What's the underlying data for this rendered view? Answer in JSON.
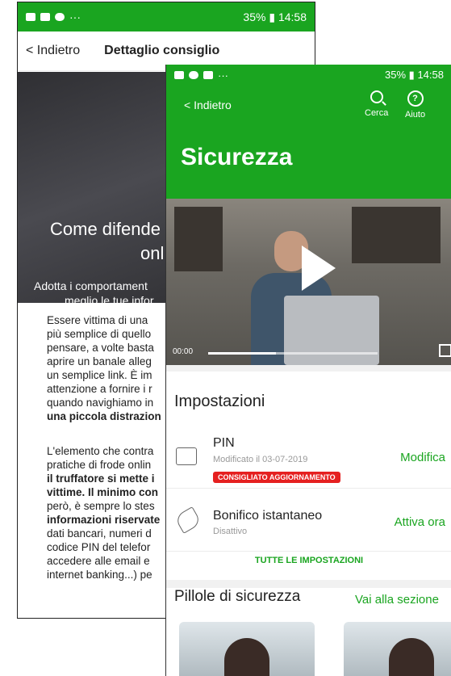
{
  "back_screen": {
    "status": {
      "battery": "35%",
      "time": "14:58",
      "dots": "···"
    },
    "nav": {
      "back_label": "< Indietro",
      "title": "Dettaglio consiglio"
    },
    "hero": {
      "title_line1": "Come difende",
      "title_line2": "onl",
      "subtitle_line1": "Adotta i comportament",
      "subtitle_line2": "meglio le tue infor"
    },
    "paragraph1": [
      "Essere vittima di una",
      "più semplice di quello",
      "pensare, a volte basta",
      "aprire un banale alleg",
      "un semplice link. È im",
      "attenzione a fornire i r",
      "quando navighiamo in",
      "una piccola distrazion"
    ],
    "paragraph2": [
      "L'elemento che contra",
      "pratiche di frode onlin",
      "il truffatore si mette i",
      "vittime. Il minimo con",
      "però, è sempre lo stes",
      "informazioni riservate",
      "dati bancari, numeri d",
      "codice PIN del telefor",
      "accedere alle email e",
      "internet banking...) pe"
    ]
  },
  "front_screen": {
    "status": {
      "battery": "35%",
      "time": "14:58",
      "dots": "···"
    },
    "nav": {
      "back_label": "< Indietro",
      "search_label": "Cerca",
      "help_label": "Aiuto"
    },
    "page_title": "Sicurezza",
    "video": {
      "time": "00:00",
      "progress": 0.4
    },
    "settings": {
      "title": "Impostazioni",
      "items": [
        {
          "name": "PIN",
          "sub": "Modificato il 03-07-2019",
          "badge": "CONSIGLIATO AGGIORNAMENTO",
          "action": "Modifica"
        },
        {
          "name": "Bonifico istantaneo",
          "sub": "Disattivo",
          "action": "Attiva ora"
        }
      ],
      "all_label": "TUTTE LE IMPOSTAZIONI"
    },
    "pills": {
      "title": "Pillole di sicurezza",
      "link": "Vai alla sezione"
    }
  },
  "colors": {
    "brand_green": "#1aa520",
    "alert_red": "#e52020"
  }
}
